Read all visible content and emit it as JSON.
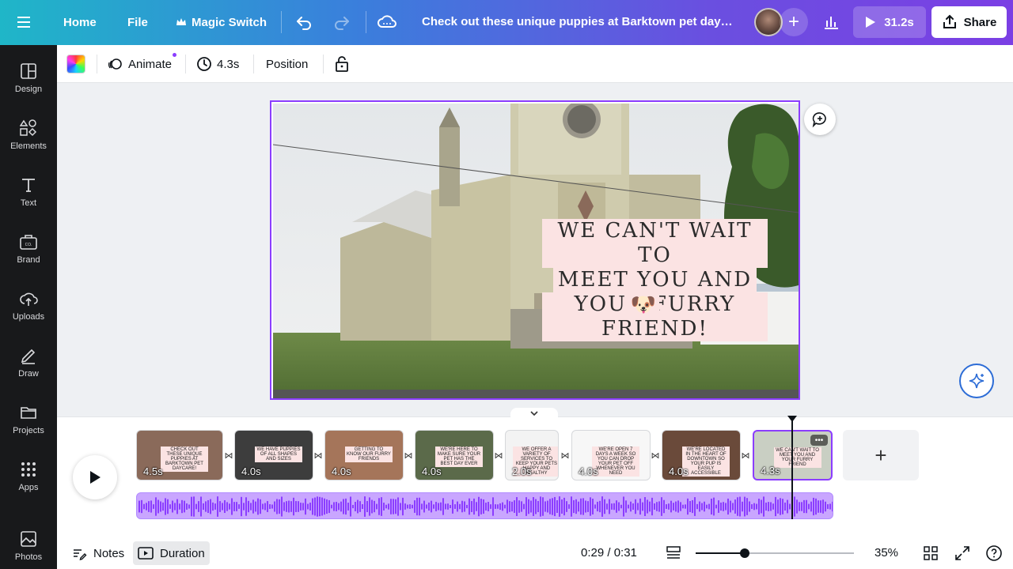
{
  "topbar": {
    "home": "Home",
    "file": "File",
    "magic_switch": "Magic Switch",
    "doc_title": "Check out these unique puppies at Barktown pet daycar...",
    "play_duration": "31.2s",
    "share": "Share",
    "icons": [
      "menu-icon",
      "crown-icon",
      "undo-icon",
      "redo-icon",
      "cloud-icon",
      "plus-icon",
      "stats-icon",
      "play-icon",
      "share-icon"
    ]
  },
  "sidebar": {
    "items": [
      {
        "label": "Design",
        "icon": "design-icon"
      },
      {
        "label": "Elements",
        "icon": "elements-icon"
      },
      {
        "label": "Text",
        "icon": "text-icon"
      },
      {
        "label": "Brand",
        "icon": "brand-icon"
      },
      {
        "label": "Uploads",
        "icon": "uploads-icon"
      },
      {
        "label": "Draw",
        "icon": "draw-icon"
      },
      {
        "label": "Projects",
        "icon": "folder-icon"
      },
      {
        "label": "Apps",
        "icon": "apps-icon"
      },
      {
        "label": "Photos",
        "icon": "photos-icon"
      }
    ]
  },
  "toolbar": {
    "animate": "Animate",
    "duration": "4.3s",
    "position": "Position"
  },
  "canvas": {
    "caption_lines": [
      "WE CAN'T WAIT TO",
      "MEET YOU AND",
      "YOUR FURRY FRIEND!"
    ],
    "emoji": "🐶"
  },
  "timeline": {
    "clips": [
      {
        "duration": "4.5s",
        "mini": "CHECK OUT THESE UNIQUE PUPPIES AT BARKTOWN PET DAYCARE!",
        "color": "#8a6a5a"
      },
      {
        "duration": "4.0s",
        "mini": "WE HAVE PUPPIES OF ALL SHAPES AND SIZES",
        "color": "#3d3d3d"
      },
      {
        "duration": "4.0s",
        "mini": "GETTING TO KNOW OUR FURRY FRIENDS",
        "color": "#a5755a"
      },
      {
        "duration": "4.0s",
        "mini": "WE'RE HERE TO MAKE SURE YOUR PET HAS THE BEST DAY EVER",
        "color": "#5b6a4a"
      },
      {
        "duration": "2.0s",
        "mini": "WE OFFER A VARIETY OF SERVICES TO KEEP YOUR PETS HAPPY AND HEALTHY",
        "color": "#f3f3f3"
      },
      {
        "duration": "4.0s",
        "mini": "WE'RE OPEN 7 DAYS A WEEK SO YOU CAN DROP YOUR PET OFF WHENEVER YOU NEED",
        "color": "#f7f7f7"
      },
      {
        "duration": "4.0s",
        "mini": "WE'RE LOCATED IN THE HEART OF DOWNTOWN SO YOUR PUP IS EASILY ACCESSIBLE",
        "color": "#6a4a3a"
      },
      {
        "duration": "4.3s",
        "mini": "WE CAN'T WAIT TO MEET YOU AND YOUR FURRY FRIEND",
        "color": "#c9cfc3"
      }
    ],
    "transition_glyph": "⋈",
    "add_glyph": "+"
  },
  "bottombar": {
    "notes": "Notes",
    "duration": "Duration",
    "time": "0:29 / 0:31",
    "zoom_percent": "35%",
    "zoom_level": 0.31
  },
  "colors": {
    "accent": "#8b3dff",
    "sidebar_bg": "#18191b",
    "caption_bg": "#fbe3e3"
  }
}
